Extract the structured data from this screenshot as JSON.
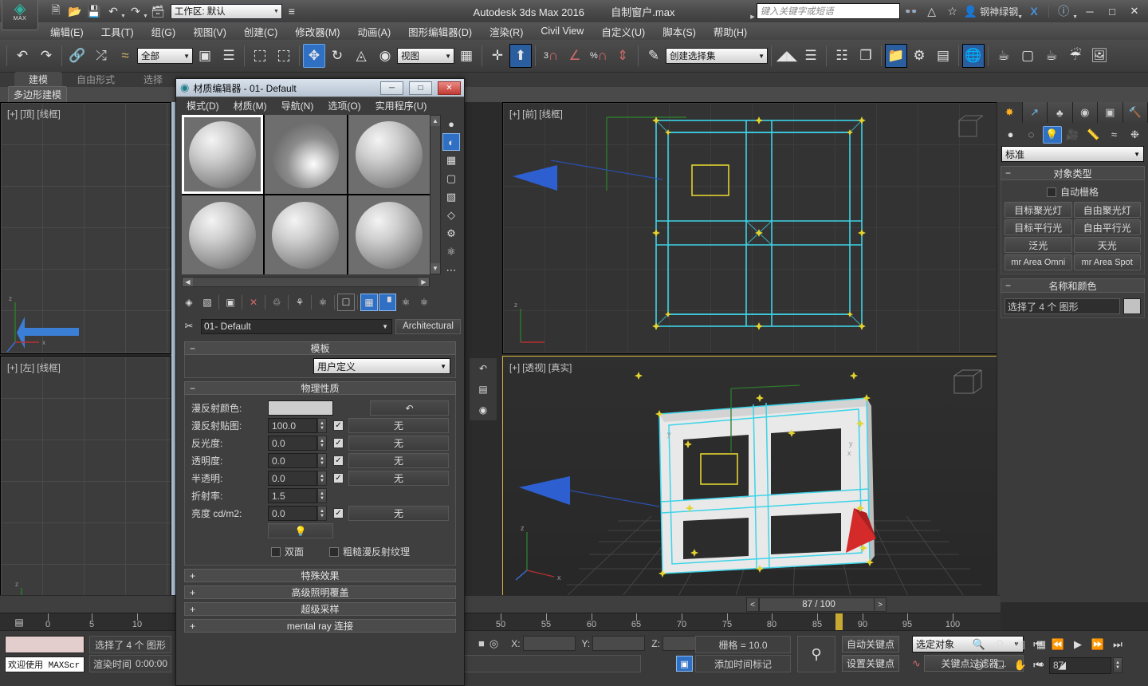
{
  "titlebar": {
    "app_title": "Autodesk 3ds Max 2016",
    "file_name": "自制窗户.max",
    "logo_text": "MAX",
    "workspace_label": "工作区: 默认",
    "search_placeholder": "键入关键字或短语",
    "user_name": "钢神绿钢",
    "icons": [
      "new-file-icon",
      "open-file-icon",
      "save-icon",
      "undo-icon",
      "redo-icon",
      "project-folder-icon"
    ],
    "window_buttons": [
      "minimize",
      "maximize",
      "close"
    ]
  },
  "menubar": {
    "items": [
      "编辑(E)",
      "工具(T)",
      "组(G)",
      "视图(V)",
      "创建(C)",
      "修改器(M)",
      "动画(A)",
      "图形编辑器(D)",
      "渲染(R)",
      "Civil View",
      "自定义(U)",
      "脚本(S)",
      "帮助(H)"
    ]
  },
  "main_toolbar": {
    "selection_filter": "全部",
    "ref_coord_system": "视图",
    "named_selection_set": "创建选择集",
    "snap_percent": "%",
    "snap_count": "3"
  },
  "ribbon": {
    "tabs": [
      "建模",
      "自由形式",
      "选择"
    ],
    "selected_tab": "建模",
    "row_button": "多边形建模"
  },
  "viewports": [
    {
      "label": "[+] [顶] [线框]",
      "name": "viewport-top"
    },
    {
      "label": "[+] [前] [线框]",
      "name": "viewport-front"
    },
    {
      "label": "[+] [左] [线框]",
      "name": "viewport-left"
    },
    {
      "label": "[+] [透视] [真实]",
      "name": "viewport-perspective"
    }
  ],
  "command_panel": {
    "tabs": [
      "create-tab",
      "modify-tab",
      "hierarchy-tab",
      "motion-tab",
      "display-tab",
      "utilities-tab"
    ],
    "object_category_icons": [
      "geometry-icon",
      "shapes-icon",
      "lights-icon",
      "cameras-icon",
      "helpers-icon",
      "space-warps-icon",
      "systems-icon"
    ],
    "selected_category": "lights-icon",
    "subcategory": "标准",
    "object_type": {
      "title": "对象类型",
      "autogrid_label": "自动栅格",
      "buttons": [
        "目标聚光灯",
        "自由聚光灯",
        "目标平行光",
        "自由平行光",
        "泛光",
        "天光",
        "mr Area Omni",
        "mr Area Spot"
      ]
    },
    "name_and_color": {
      "title": "名称和颜色",
      "value": "选择了 4 个 图形",
      "color": "#c2c2c2"
    }
  },
  "material_editor": {
    "title": "材质编辑器 - 01- Default",
    "menu": [
      "模式(D)",
      "材质(M)",
      "导航(N)",
      "选项(O)",
      "实用程序(U)"
    ],
    "slots": [
      {
        "id": "slot-1",
        "selected": true,
        "style": "normal"
      },
      {
        "id": "slot-2",
        "selected": false,
        "style": "highlight"
      },
      {
        "id": "slot-3",
        "selected": false,
        "style": "normal"
      },
      {
        "id": "slot-4",
        "selected": false,
        "style": "normal"
      },
      {
        "id": "slot-5",
        "selected": false,
        "style": "normal"
      },
      {
        "id": "slot-6",
        "selected": false,
        "style": "normal"
      }
    ],
    "side_tools": [
      "sample-type-icon",
      "backlight-icon",
      "background-checker-icon",
      "sample-uv-tiling-icon",
      "video-color-check-icon",
      "make-preview-icon",
      "options-icon",
      "select-by-material-icon",
      "material-id-channel-icon"
    ],
    "toolbar_icons": [
      "get-material-icon",
      "put-material-to-scene-icon",
      "assign-material-to-selection-icon",
      "reset-map-icon",
      "make-material-copy-icon",
      "make-unique-icon",
      "put-to-library-icon",
      "material-effects-id-icon",
      "show-shaded-material-in-viewport-icon",
      "show-end-result-icon",
      "go-to-parent-icon",
      "go-forward-to-sibling-icon"
    ],
    "material_name": "01- Default",
    "material_type_button": "Architectural",
    "eyedropper_icon": "pick-material-from-object-icon",
    "rollouts": {
      "template": {
        "title": "模板",
        "value": "用户定义",
        "expanded": true
      },
      "physical": {
        "title": "物理性质",
        "expanded": true,
        "params": [
          {
            "label": "漫反射颜色:",
            "kind": "color",
            "color": "#cdcdcd",
            "map_button": "",
            "checked": false,
            "map_icon": "reset-arrow-icon"
          },
          {
            "label": "漫反射贴图:",
            "kind": "spin",
            "value": "100.0",
            "checked": true,
            "map_button": "无"
          },
          {
            "label": "反光度:",
            "kind": "spin",
            "value": "0.0",
            "checked": true,
            "map_button": "无"
          },
          {
            "label": "透明度:",
            "kind": "spin",
            "value": "0.0",
            "checked": true,
            "map_button": "无"
          },
          {
            "label": "半透明:",
            "kind": "spin",
            "value": "0.0",
            "checked": true,
            "map_button": "无"
          },
          {
            "label": "折射率:",
            "kind": "spin",
            "value": "1.5",
            "checked": null,
            "map_button": ""
          },
          {
            "label": "亮度 cd/m2:",
            "kind": "spin",
            "value": "0.0",
            "checked": true,
            "map_button": "无"
          }
        ],
        "light_button_icon": "light-preview-icon",
        "checkboxes": [
          {
            "label": "双面",
            "checked": false
          },
          {
            "label": "粗糙漫反射纹理",
            "checked": false
          }
        ]
      },
      "collapsed": [
        {
          "title": "特殊效果"
        },
        {
          "title": "高级照明覆盖"
        },
        {
          "title": "超级采样"
        },
        {
          "title": "mental ray 连接"
        }
      ]
    }
  },
  "timeline": {
    "current_frame_display": "87 / 100",
    "prev_frame_button": "<",
    "next_frame_button": ">",
    "ruler_labels": [
      "0",
      "5",
      "10",
      "50",
      "55",
      "60",
      "65",
      "70",
      "75",
      "80",
      "85",
      "90",
      "95",
      "100"
    ],
    "thumb_frame": 87
  },
  "status_bar": {
    "maxscript_prompt": "欢迎使用 MAXScr",
    "selection_status": "选择了 4 个 图形",
    "render_time_label": "渲染时间",
    "render_time_value": "0:00:00",
    "coord_labels": [
      "X:",
      "Y:",
      "Z:"
    ],
    "coord_values": [
      "",
      "",
      ""
    ],
    "grid_label": "栅格 = 10.0",
    "add_time_tag": "添加时间标记",
    "auto_key": "自动关键点",
    "set_key": "设置关键点",
    "key_filter": "关键点过滤器...",
    "selected_objects": "选定对象",
    "frame_value": "87",
    "playback_icons": [
      "go-to-start-icon",
      "previous-frame-icon",
      "play-icon",
      "next-frame-icon",
      "go-to-end-icon"
    ],
    "nav_icons": [
      "zoom-icon",
      "zoom-all-icon",
      "zoom-extents-icon",
      "zoom-extents-all-icon",
      "field-of-view-icon",
      "region-zoom-icon",
      "pan-icon",
      "orbit-icon",
      "maximize-viewport-icon"
    ]
  }
}
